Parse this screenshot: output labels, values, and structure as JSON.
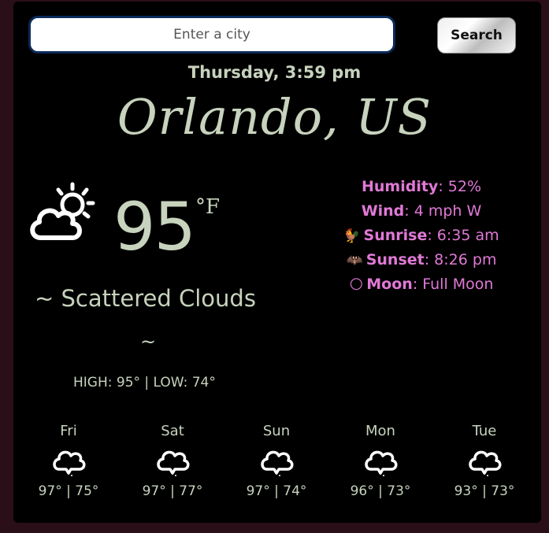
{
  "search": {
    "placeholder": "Enter a city",
    "button_label": "Search"
  },
  "current": {
    "datetime": "Thursday, 3:59 pm",
    "city": "Orlando, US",
    "icon": "partly-cloudy-icon",
    "temperature": "95",
    "unit": "°F",
    "description": "~ Scattered Clouds",
    "description_tail": "~",
    "high_low": "HIGH: 95° | LOW: 74°"
  },
  "details": {
    "humidity": {
      "label": "Humidity",
      "value": ": 52%"
    },
    "wind": {
      "label": "Wind",
      "value": ": 4 mph W"
    },
    "sunrise": {
      "emoji": "🐓",
      "label": "Sunrise",
      "value": ": 6:35 am"
    },
    "sunset": {
      "emoji": "🦇",
      "label": "Sunset",
      "value": ": 8:26 pm"
    },
    "moon": {
      "emoji": "🌕",
      "label": "Moon",
      "value": ": Full Moon"
    }
  },
  "forecast": [
    {
      "day": "Fri",
      "temps": "97° | 75°",
      "icon": "cloud-icon"
    },
    {
      "day": "Sat",
      "temps": "97° | 77°",
      "icon": "cloud-icon"
    },
    {
      "day": "Sun",
      "temps": "97° | 74°",
      "icon": "cloud-icon"
    },
    {
      "day": "Mon",
      "temps": "96° | 73°",
      "icon": "cloud-icon"
    },
    {
      "day": "Tue",
      "temps": "93° | 73°",
      "icon": "cloud-icon"
    }
  ],
  "colors": {
    "background": "#2a0f18",
    "card": "#000000",
    "text": "#c7d3bd",
    "accent": "#e079d6"
  }
}
